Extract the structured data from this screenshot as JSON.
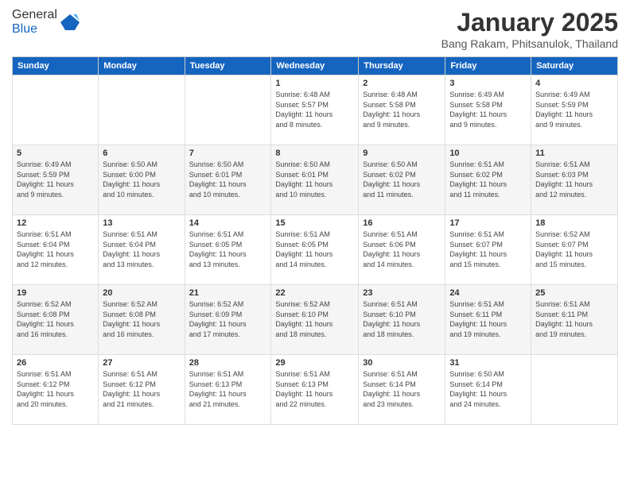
{
  "header": {
    "logo_general": "General",
    "logo_blue": "Blue",
    "month_title": "January 2025",
    "location": "Bang Rakam, Phitsanulok, Thailand"
  },
  "days_of_week": [
    "Sunday",
    "Monday",
    "Tuesday",
    "Wednesday",
    "Thursday",
    "Friday",
    "Saturday"
  ],
  "weeks": [
    [
      {
        "day": "",
        "info": ""
      },
      {
        "day": "",
        "info": ""
      },
      {
        "day": "",
        "info": ""
      },
      {
        "day": "1",
        "info": "Sunrise: 6:48 AM\nSunset: 5:57 PM\nDaylight: 11 hours\nand 8 minutes."
      },
      {
        "day": "2",
        "info": "Sunrise: 6:48 AM\nSunset: 5:58 PM\nDaylight: 11 hours\nand 9 minutes."
      },
      {
        "day": "3",
        "info": "Sunrise: 6:49 AM\nSunset: 5:58 PM\nDaylight: 11 hours\nand 9 minutes."
      },
      {
        "day": "4",
        "info": "Sunrise: 6:49 AM\nSunset: 5:59 PM\nDaylight: 11 hours\nand 9 minutes."
      }
    ],
    [
      {
        "day": "5",
        "info": "Sunrise: 6:49 AM\nSunset: 5:59 PM\nDaylight: 11 hours\nand 9 minutes."
      },
      {
        "day": "6",
        "info": "Sunrise: 6:50 AM\nSunset: 6:00 PM\nDaylight: 11 hours\nand 10 minutes."
      },
      {
        "day": "7",
        "info": "Sunrise: 6:50 AM\nSunset: 6:01 PM\nDaylight: 11 hours\nand 10 minutes."
      },
      {
        "day": "8",
        "info": "Sunrise: 6:50 AM\nSunset: 6:01 PM\nDaylight: 11 hours\nand 10 minutes."
      },
      {
        "day": "9",
        "info": "Sunrise: 6:50 AM\nSunset: 6:02 PM\nDaylight: 11 hours\nand 11 minutes."
      },
      {
        "day": "10",
        "info": "Sunrise: 6:51 AM\nSunset: 6:02 PM\nDaylight: 11 hours\nand 11 minutes."
      },
      {
        "day": "11",
        "info": "Sunrise: 6:51 AM\nSunset: 6:03 PM\nDaylight: 11 hours\nand 12 minutes."
      }
    ],
    [
      {
        "day": "12",
        "info": "Sunrise: 6:51 AM\nSunset: 6:04 PM\nDaylight: 11 hours\nand 12 minutes."
      },
      {
        "day": "13",
        "info": "Sunrise: 6:51 AM\nSunset: 6:04 PM\nDaylight: 11 hours\nand 13 minutes."
      },
      {
        "day": "14",
        "info": "Sunrise: 6:51 AM\nSunset: 6:05 PM\nDaylight: 11 hours\nand 13 minutes."
      },
      {
        "day": "15",
        "info": "Sunrise: 6:51 AM\nSunset: 6:05 PM\nDaylight: 11 hours\nand 14 minutes."
      },
      {
        "day": "16",
        "info": "Sunrise: 6:51 AM\nSunset: 6:06 PM\nDaylight: 11 hours\nand 14 minutes."
      },
      {
        "day": "17",
        "info": "Sunrise: 6:51 AM\nSunset: 6:07 PM\nDaylight: 11 hours\nand 15 minutes."
      },
      {
        "day": "18",
        "info": "Sunrise: 6:52 AM\nSunset: 6:07 PM\nDaylight: 11 hours\nand 15 minutes."
      }
    ],
    [
      {
        "day": "19",
        "info": "Sunrise: 6:52 AM\nSunset: 6:08 PM\nDaylight: 11 hours\nand 16 minutes."
      },
      {
        "day": "20",
        "info": "Sunrise: 6:52 AM\nSunset: 6:08 PM\nDaylight: 11 hours\nand 16 minutes."
      },
      {
        "day": "21",
        "info": "Sunrise: 6:52 AM\nSunset: 6:09 PM\nDaylight: 11 hours\nand 17 minutes."
      },
      {
        "day": "22",
        "info": "Sunrise: 6:52 AM\nSunset: 6:10 PM\nDaylight: 11 hours\nand 18 minutes."
      },
      {
        "day": "23",
        "info": "Sunrise: 6:51 AM\nSunset: 6:10 PM\nDaylight: 11 hours\nand 18 minutes."
      },
      {
        "day": "24",
        "info": "Sunrise: 6:51 AM\nSunset: 6:11 PM\nDaylight: 11 hours\nand 19 minutes."
      },
      {
        "day": "25",
        "info": "Sunrise: 6:51 AM\nSunset: 6:11 PM\nDaylight: 11 hours\nand 19 minutes."
      }
    ],
    [
      {
        "day": "26",
        "info": "Sunrise: 6:51 AM\nSunset: 6:12 PM\nDaylight: 11 hours\nand 20 minutes."
      },
      {
        "day": "27",
        "info": "Sunrise: 6:51 AM\nSunset: 6:12 PM\nDaylight: 11 hours\nand 21 minutes."
      },
      {
        "day": "28",
        "info": "Sunrise: 6:51 AM\nSunset: 6:13 PM\nDaylight: 11 hours\nand 21 minutes."
      },
      {
        "day": "29",
        "info": "Sunrise: 6:51 AM\nSunset: 6:13 PM\nDaylight: 11 hours\nand 22 minutes."
      },
      {
        "day": "30",
        "info": "Sunrise: 6:51 AM\nSunset: 6:14 PM\nDaylight: 11 hours\nand 23 minutes."
      },
      {
        "day": "31",
        "info": "Sunrise: 6:50 AM\nSunset: 6:14 PM\nDaylight: 11 hours\nand 24 minutes."
      },
      {
        "day": "",
        "info": ""
      }
    ]
  ]
}
